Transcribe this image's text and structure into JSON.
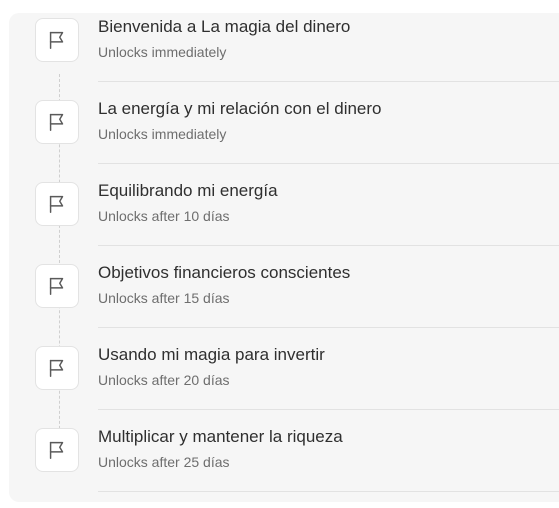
{
  "lessons": [
    {
      "title": "Bienvenida a La magia del dinero",
      "unlock": "Unlocks immediately",
      "icon": "flag-icon"
    },
    {
      "title": "La energía y mi relación con el dinero",
      "unlock": "Unlocks immediately",
      "icon": "flag-icon"
    },
    {
      "title": "Equilibrando mi energía",
      "unlock": "Unlocks after 10 días",
      "icon": "flag-icon"
    },
    {
      "title": "Objetivos financieros conscientes",
      "unlock": "Unlocks after 15 días",
      "icon": "flag-icon"
    },
    {
      "title": "Usando mi magia para invertir",
      "unlock": "Unlocks after 20 días",
      "icon": "flag-icon"
    },
    {
      "title": "Multiplicar y mantener la riqueza",
      "unlock": "Unlocks after 25 días",
      "icon": "flag-icon"
    }
  ],
  "colors": {
    "panel_bg": "#f6f6f6",
    "title_text": "#2f2f2f",
    "subtitle_text": "#6e6e6e",
    "icon_stroke": "#5a5a5a"
  }
}
